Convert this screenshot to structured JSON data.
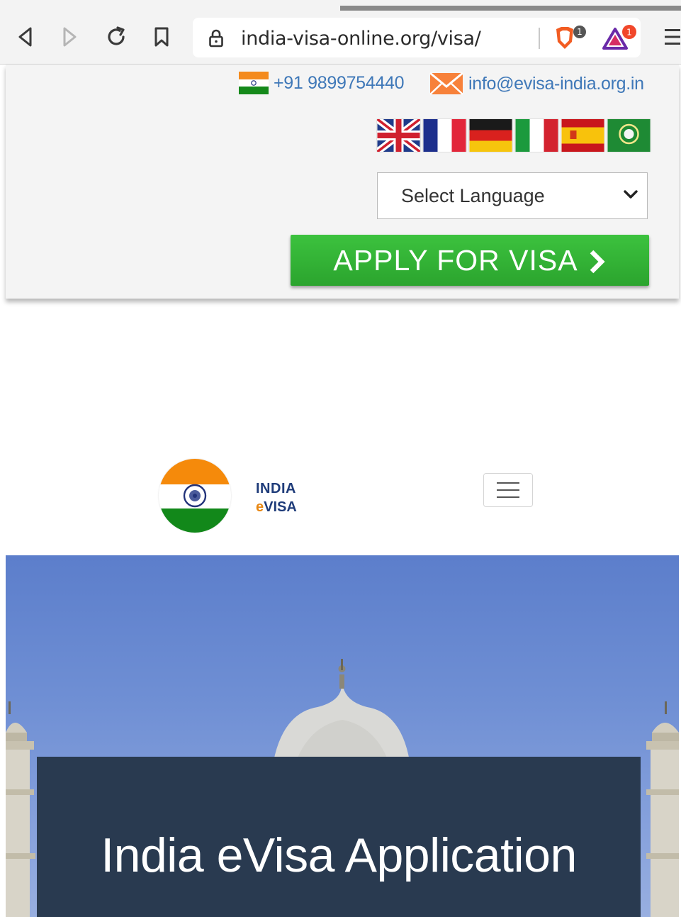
{
  "browser": {
    "url": "india-visa-online.org/visa/",
    "extensions": [
      {
        "name": "brave-shields-icon",
        "badge": "1"
      },
      {
        "name": "brave-rewards-icon",
        "badge": "1"
      }
    ]
  },
  "topbar": {
    "phone": "+91 9899754440",
    "email": "info@evisa-india.org.in",
    "language_select": "Select Language",
    "flags": [
      "uk-flag",
      "france-flag",
      "germany-flag",
      "italy-flag",
      "spain-flag",
      "arab-league-flag"
    ],
    "apply_label": "APPLY FOR VISA"
  },
  "header": {
    "logo_line1": "INDIA",
    "logo_line2_e": "e",
    "logo_line2_rest": "VISA"
  },
  "hero": {
    "title": "India eVisa Application"
  },
  "colors": {
    "apply_green": "#33b536",
    "link_blue": "#3f78b8",
    "hero_card": "#293a50",
    "logo_navy": "#1f3c7a",
    "logo_orange": "#e88712"
  }
}
